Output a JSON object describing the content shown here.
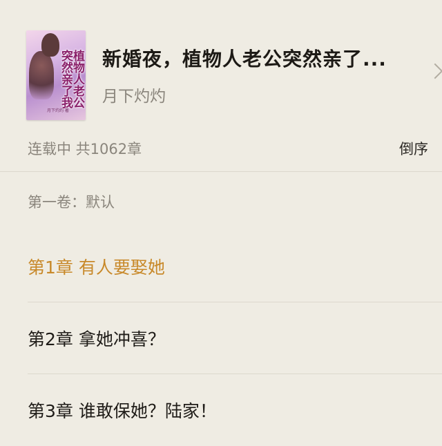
{
  "book": {
    "title": "新婚夜，植物人老公突然亲了...",
    "author": "月下灼灼",
    "cover_text": "植物人老公突然亲了我",
    "cover_author": "月下灼灼 著"
  },
  "status": {
    "text": "连载中 共1062章",
    "sort_label": "倒序"
  },
  "volume": {
    "label": "第一卷：默认"
  },
  "chapters": [
    {
      "label": "第1章 有人要娶她",
      "active": true
    },
    {
      "label": "第2章 拿她冲喜？",
      "active": false
    },
    {
      "label": "第3章 谁敢保她？陆家！",
      "active": false
    }
  ],
  "colors": {
    "background": "#efece3",
    "active_chapter": "#c8892a",
    "muted_text": "#8a857c"
  },
  "icons": {
    "chevron": "chevron-right-icon"
  }
}
